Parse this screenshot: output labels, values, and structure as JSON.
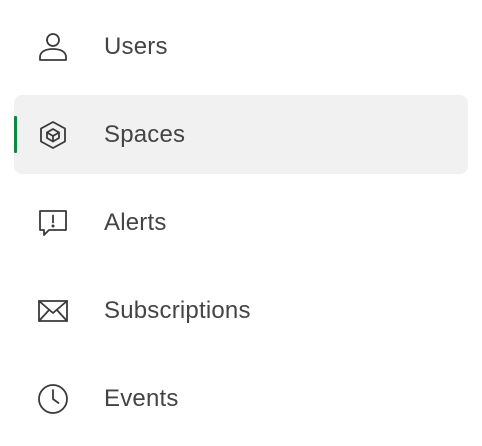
{
  "nav": {
    "accent_color": "#0b8a3e",
    "active_background": "#f1f1f1",
    "items": [
      {
        "label": "Users",
        "icon": "user-icon",
        "active": false
      },
      {
        "label": "Spaces",
        "icon": "cube-icon",
        "active": true
      },
      {
        "label": "Alerts",
        "icon": "alert-message-icon",
        "active": false
      },
      {
        "label": "Subscriptions",
        "icon": "envelope-icon",
        "active": false
      },
      {
        "label": "Events",
        "icon": "clock-icon",
        "active": false
      }
    ]
  }
}
